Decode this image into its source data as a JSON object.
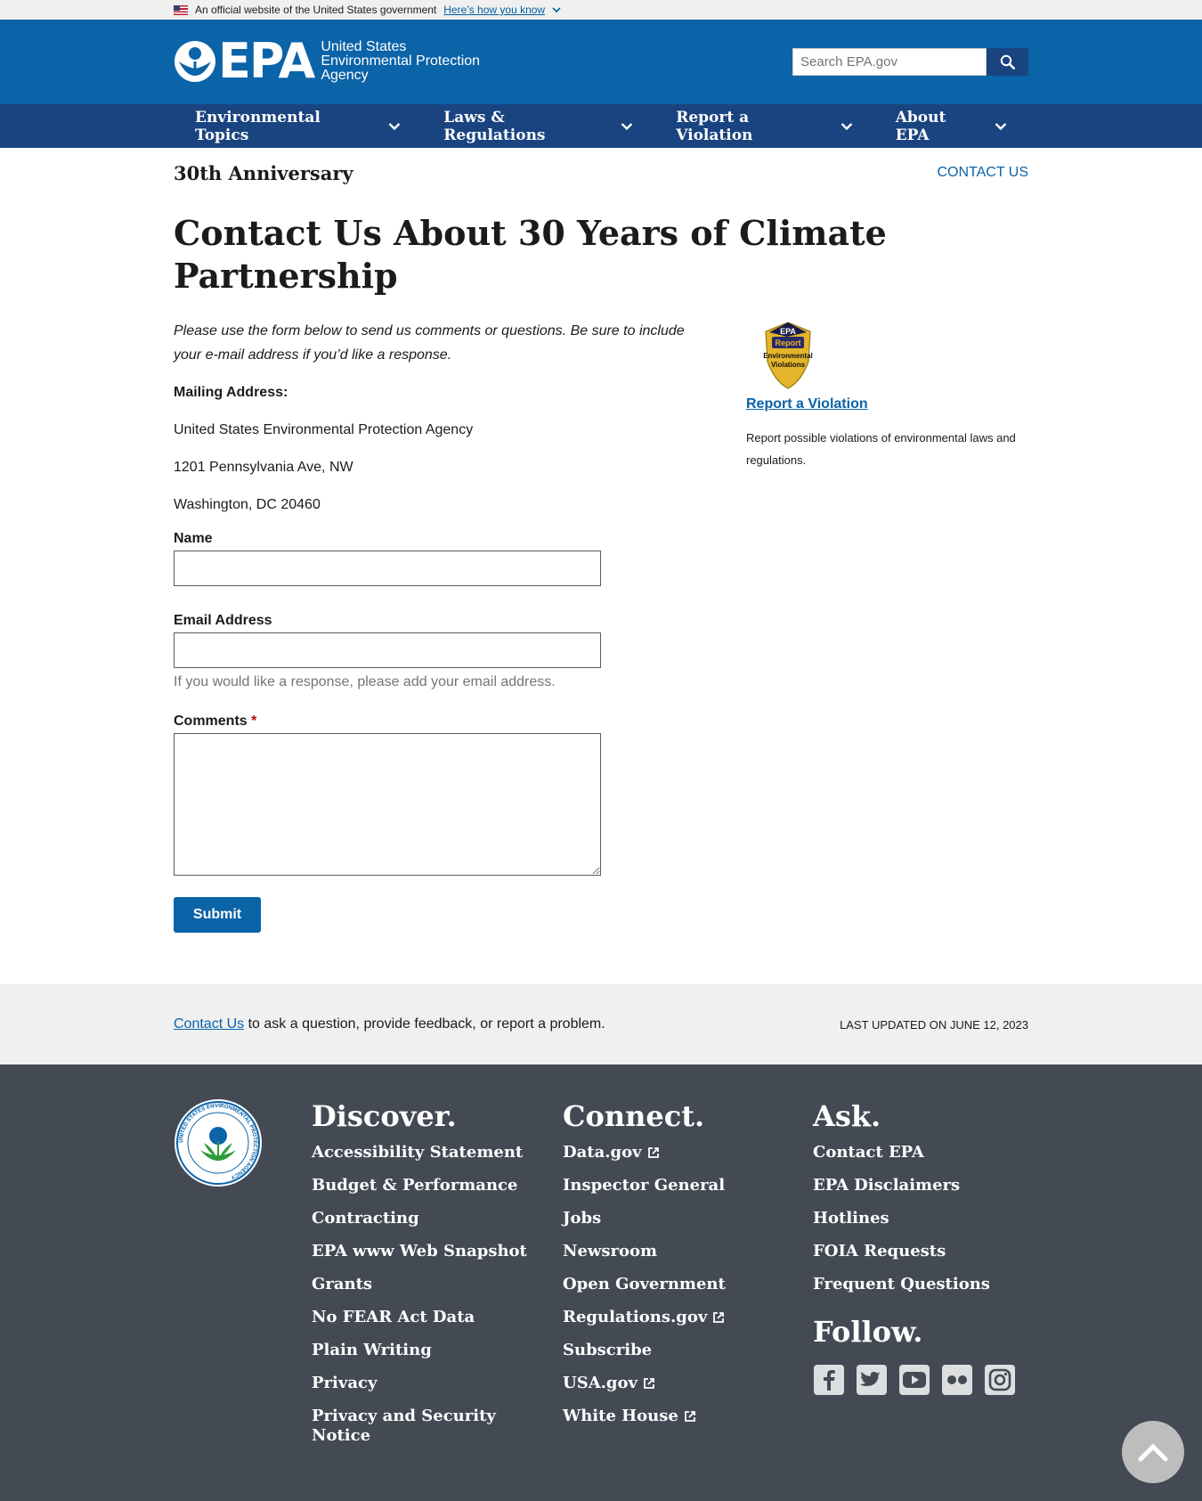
{
  "gov_banner": {
    "text": "An official website of the United States government",
    "link": "Here’s how you know"
  },
  "header": {
    "logo_epa": "EPA",
    "logo_line1": "United States",
    "logo_line2": "Environmental Protection",
    "logo_line3": "Agency",
    "search_placeholder": "Search EPA.gov"
  },
  "nav": [
    {
      "label": "Environmental Topics"
    },
    {
      "label": "Laws & Regulations"
    },
    {
      "label": "Report a Violation"
    },
    {
      "label": "About EPA"
    }
  ],
  "page": {
    "section_title": "30th Anniversary",
    "contact_link": "CONTACT US",
    "title": "Contact Us About 30 Years of Climate Partnership",
    "intro": "Please use the form below to send us comments or questions. Be sure to include your e-mail address if you’d like a response.",
    "mailing_label": "Mailing Address:",
    "address1": "United States Environmental Protection Agency",
    "address2": "1201 Pennsylvania Ave, NW",
    "address3": "Washington, DC 20460"
  },
  "form": {
    "name_label": "Name",
    "email_label": "Email Address",
    "email_hint": "If you would like a response, please add your email address.",
    "comments_label": "Comments",
    "required_mark": "*",
    "submit": "Submit"
  },
  "sidebar": {
    "badge_line1": "EPA",
    "badge_line2": "Report",
    "badge_line3": "Environmental",
    "badge_line4": "Violations",
    "link": "Report a Violation",
    "desc": "Report possible violations of environmental laws and regulations."
  },
  "updated": {
    "contact_link": "Contact Us",
    "contact_text": " to ask a question, provide feedback, or report a problem.",
    "last_updated": "LAST UPDATED ON JUNE 12, 2023"
  },
  "footer": {
    "discover": {
      "heading": "Discover.",
      "links": [
        "Accessibility Statement",
        "Budget & Performance",
        "Contracting",
        "EPA www Web Snapshot",
        "Grants",
        "No FEAR Act Data",
        "Plain Writing",
        "Privacy",
        "Privacy and Security Notice"
      ]
    },
    "connect": {
      "heading": "Connect.",
      "links": [
        "Data.gov",
        "Inspector General",
        "Jobs",
        "Newsroom",
        "Open Government",
        "Regulations.gov",
        "Subscribe",
        "USA.gov",
        "White House"
      ]
    },
    "ask": {
      "heading": "Ask.",
      "links": [
        "Contact EPA",
        "EPA Disclaimers",
        "Hotlines",
        "FOIA Requests",
        "Frequent Questions"
      ]
    },
    "follow_heading": "Follow.",
    "social_icons": [
      "facebook-icon",
      "twitter-icon",
      "youtube-icon",
      "flickr-icon",
      "instagram-icon"
    ],
    "seal_text": "UNITED STATES ENVIRONMENTAL PROTECTION AGENCY"
  },
  "colors": {
    "header_blue": "#0b63a8",
    "nav_blue": "#1a4480",
    "footer_gray": "#444a54",
    "link_blue": "#0b63a8"
  }
}
